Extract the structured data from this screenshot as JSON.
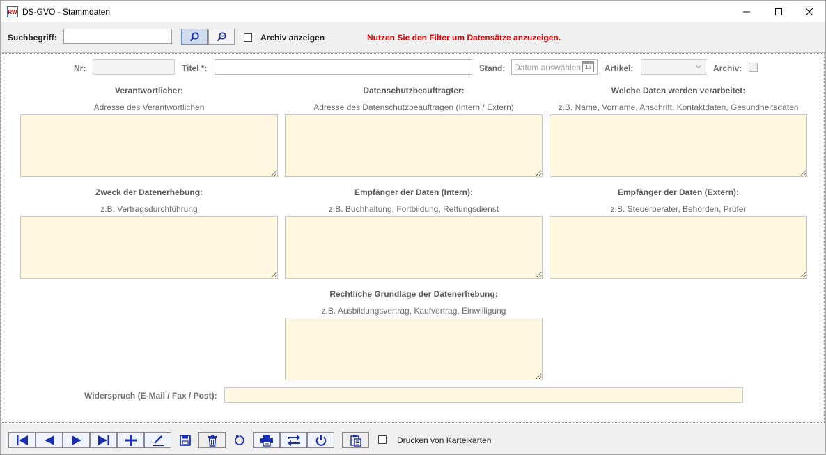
{
  "window": {
    "title": "DS-GVO - Stammdaten",
    "icon_text": "RW",
    "controls": [
      "minimize-icon",
      "maximize-icon",
      "close-icon"
    ]
  },
  "toolbar": {
    "search_label": "Suchbegriff:",
    "search_value": "",
    "search_icon": "search-icon",
    "zoom_out_icon": "zoom-out-icon",
    "archive_label": "Archiv anzeigen",
    "archive_checked": false,
    "filter_message": "Nutzen Sie den Filter um Datensätze anzuzeigen.",
    "filter_message_color": "#e00000"
  },
  "form": {
    "nr_label": "Nr:",
    "nr_value": "",
    "title_label": "Titel *:",
    "title_value": "",
    "stand_label": "Stand:",
    "stand_placeholder": "Datum auswählen",
    "calendar_day": "15",
    "artikel_label": "Artikel:",
    "artikel_value": "",
    "archiv_label": "Archiv:",
    "archiv_checked": false,
    "sections": {
      "verantwortlicher": {
        "title": "Verantwortlicher:",
        "hint": "Adresse des Verantwortlichen"
      },
      "dsb": {
        "title": "Datenschutzbeauftragter:",
        "hint": "Adresse des Datenschutzbeauftragen (Intern / Extern)"
      },
      "daten": {
        "title": "Welche Daten werden verarbeitet:",
        "hint": "z.B. Name, Vorname, Anschrift, Kontaktdaten, Gesundheitsdaten"
      },
      "zweck": {
        "title": "Zweck der Datenerhebung:",
        "hint": "z.B. Vertragsdurchführung"
      },
      "empf_intern": {
        "title": "Empfänger der Daten (Intern):",
        "hint": "z.B. Buchhaltung, Fortbildung, Rettungsdienst"
      },
      "empf_extern": {
        "title": "Empfänger der Daten (Extern):",
        "hint": "z.B. Steuerberater, Behörden, Prüfer"
      },
      "grundlage": {
        "title": "Rechtliche Grundlage der Datenerhebung:",
        "hint": "z.B. Ausbildungsvertrag, Kaufvertrag, Einwilligung"
      }
    },
    "widerspruch_label": "Widerspruch (E-Mail / Fax / Post):",
    "widerspruch_value": "",
    "field_bg_color": "#fff7e0"
  },
  "bottom": {
    "nav_icons": [
      "first-record-icon",
      "previous-record-icon",
      "next-record-icon",
      "last-record-icon",
      "add-icon",
      "edit-icon",
      "save-icon",
      "delete-icon",
      "refresh-icon",
      "print-icon",
      "swap-icon",
      "power-icon",
      "clipboard-icon"
    ],
    "print_cards_label": "Drucken von Karteikarten",
    "print_cards_checked": false,
    "icon_color": "#1a2fb0"
  }
}
